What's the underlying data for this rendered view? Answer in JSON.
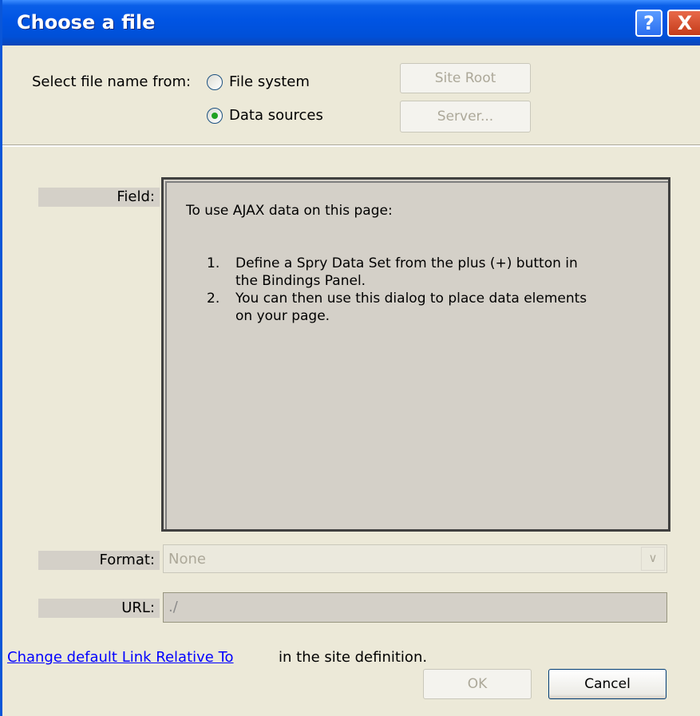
{
  "window": {
    "title": "Choose a file",
    "help_label": "?",
    "close_label": "X"
  },
  "select_from": {
    "label": "Select file name from:",
    "options": [
      {
        "label": "File system",
        "selected": false
      },
      {
        "label": "Data sources",
        "selected": true
      }
    ]
  },
  "buttons": {
    "site_root": "Site Root",
    "server": "Server...",
    "ok": "OK",
    "cancel": "Cancel"
  },
  "field": {
    "label": "Field:",
    "message": "To use AJAX data on this page:",
    "steps": [
      {
        "num": "1.",
        "lines": [
          "Define a Spry Data Set from the plus (+) button in",
          "the Bindings Panel."
        ]
      },
      {
        "num": "2.",
        "lines": [
          "You can then use this dialog to place data elements",
          "on your page."
        ]
      }
    ]
  },
  "format": {
    "label": "Format:",
    "value": "None"
  },
  "url": {
    "label": "URL:",
    "value": "./"
  },
  "footer": {
    "link_text": "Change default Link Relative To",
    "link_tail": "in the site definition."
  },
  "colors": {
    "titlebar": "#0054e3",
    "dialog_bg": "#ece9d8",
    "link": "#0000ff",
    "radio_dot": "#21a121"
  }
}
